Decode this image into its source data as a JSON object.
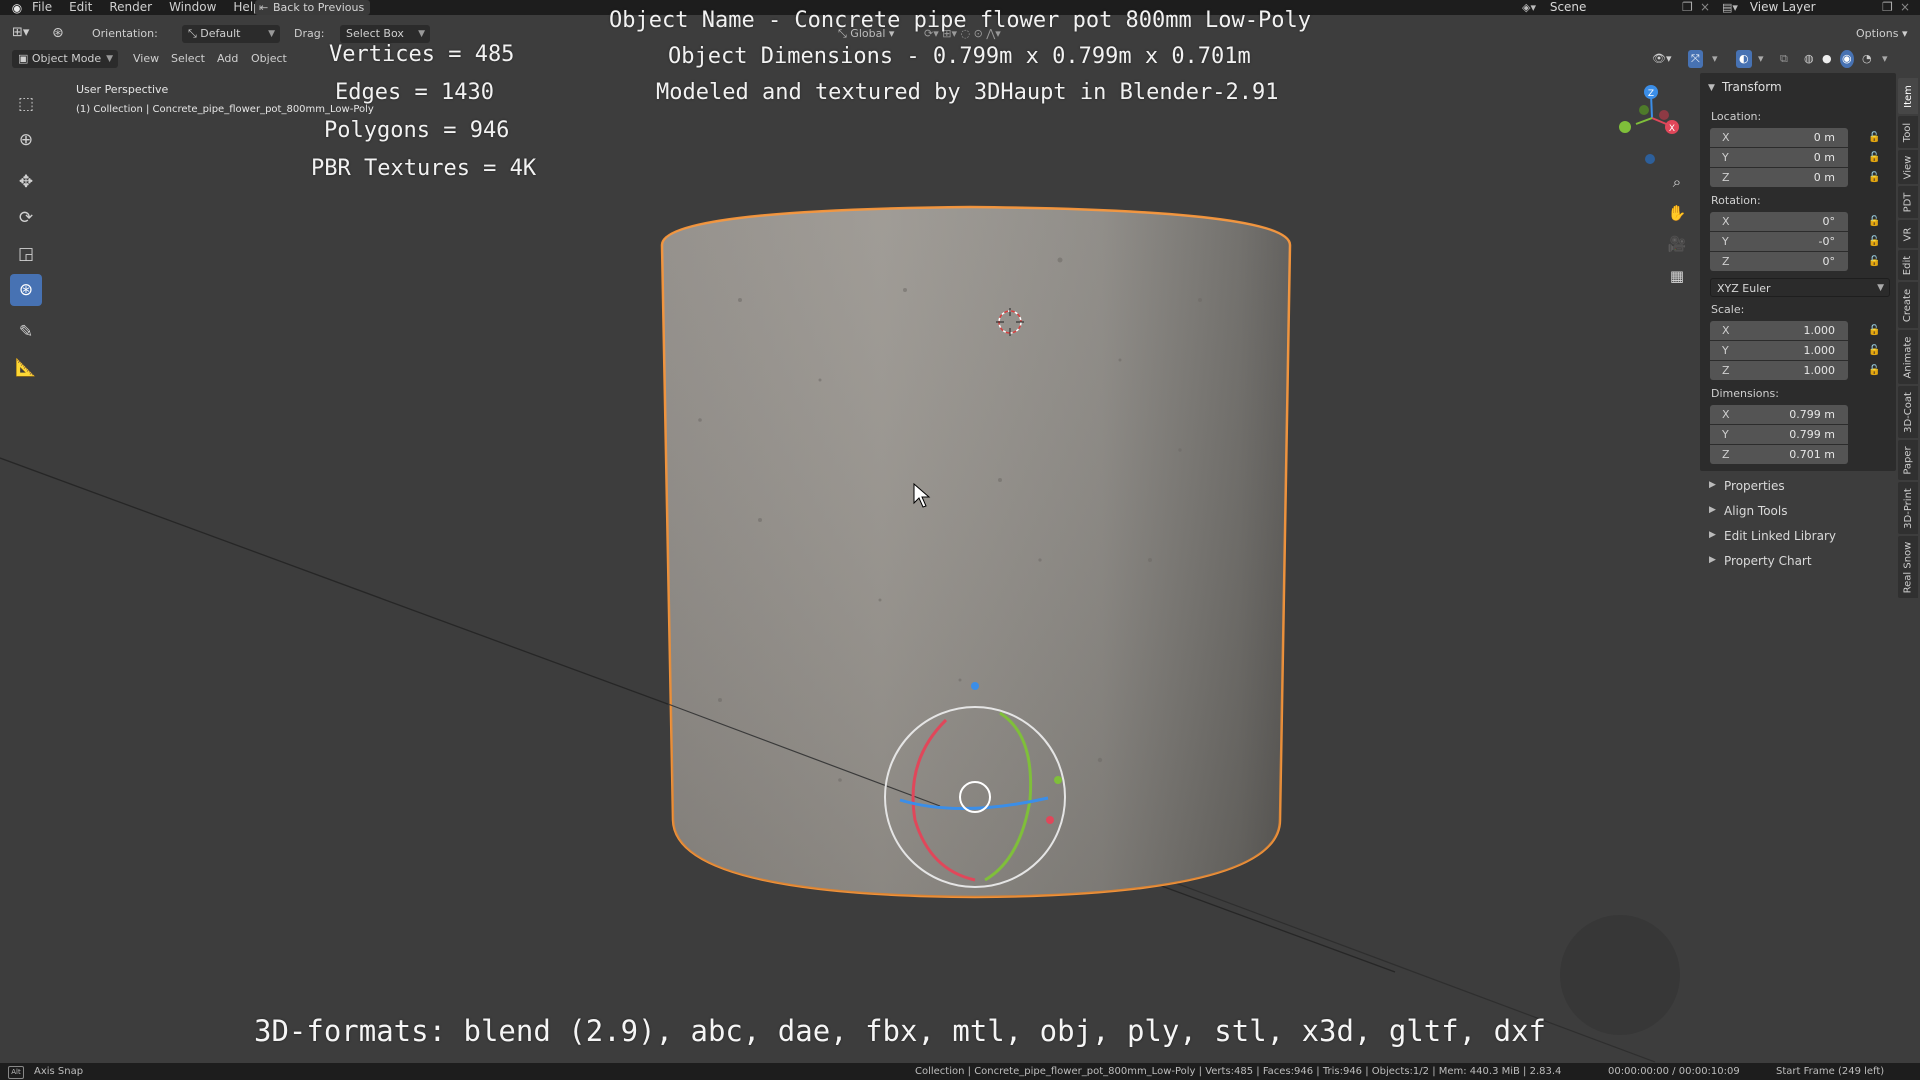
{
  "menu": {
    "items": [
      "File",
      "Edit",
      "Render",
      "Window",
      "Help"
    ],
    "back_button": "Back to Previous"
  },
  "scene": {
    "label": "Scene"
  },
  "view_layer": {
    "label": "View Layer"
  },
  "header": {
    "orientation_label": "Orientation:",
    "orientation_value": "Default",
    "drag_label": "Drag:",
    "drag_value": "Select Box",
    "transform_space": "Global",
    "options_label": "Options",
    "mode": "Object Mode",
    "menus": [
      "View",
      "Select",
      "Add",
      "Object"
    ]
  },
  "viewport": {
    "perspective_label": "User Perspective",
    "collection_label": "(1) Collection | Concrete_pipe_flower_pot_800mm_Low-Poly",
    "stats": {
      "vertices": "Vertices = 485",
      "edges": "Edges = 1430",
      "polygons": "Polygons = 946",
      "textures": "PBR Textures = 4K"
    },
    "overlay_title": "Object Name - Concrete pipe flower pot 800mm Low-Poly",
    "overlay_dimensions": "Object Dimensions -  0.799m x 0.799m x 0.701m",
    "overlay_credit": "Modeled and textured by 3DHaupt in Blender-2.91",
    "formats_line": "3D-formats: blend (2.9), abc, dae, fbx, mtl, obj, ply, stl, x3d, gltf, dxf",
    "gizmo_axes": {
      "x": "X",
      "y": "Y",
      "z": "Z"
    }
  },
  "npanel": {
    "transform_title": "Transform",
    "location_label": "Location:",
    "location": [
      {
        "axis": "X",
        "value": "0 m"
      },
      {
        "axis": "Y",
        "value": "0 m"
      },
      {
        "axis": "Z",
        "value": "0 m"
      }
    ],
    "rotation_label": "Rotation:",
    "rotation": [
      {
        "axis": "X",
        "value": "0°"
      },
      {
        "axis": "Y",
        "value": "-0°"
      },
      {
        "axis": "Z",
        "value": "0°"
      }
    ],
    "rotation_mode": "XYZ Euler",
    "scale_label": "Scale:",
    "scale": [
      {
        "axis": "X",
        "value": "1.000"
      },
      {
        "axis": "Y",
        "value": "1.000"
      },
      {
        "axis": "Z",
        "value": "1.000"
      }
    ],
    "dimensions_label": "Dimensions:",
    "dimensions": [
      {
        "axis": "X",
        "value": "0.799 m"
      },
      {
        "axis": "Y",
        "value": "0.799 m"
      },
      {
        "axis": "Z",
        "value": "0.701 m"
      }
    ],
    "collapsed_sections": [
      "Properties",
      "Align Tools",
      "Edit Linked Library",
      "Property Chart"
    ]
  },
  "vertical_tabs": [
    "Item",
    "Tool",
    "View",
    "PDT",
    "VR",
    "Edit",
    "Create",
    "Animate",
    "3D-Coat",
    "Paper",
    "3D-Print",
    "Real Snow"
  ],
  "status": {
    "key_hint": "Alt",
    "snap_label": "Axis Snap",
    "info": "Collection | Concrete_pipe_flower_pot_800mm_Low-Poly | Verts:485 | Faces:946 | Tris:946 | Objects:1/2 | Mem: 440.3 MiB | 2.83.4",
    "time": "00:00:00:00 / 00:00:10:09",
    "frame": "Start Frame (249 left)"
  },
  "colors": {
    "selection_outline": "#f0923a",
    "active_tool": "#4772b3",
    "axis_x": "#e0475a",
    "axis_y": "#7fbf3a",
    "axis_z": "#3b8ee8",
    "viewport_bg": "#3d3d3d"
  },
  "icons": {
    "toolbar": [
      "select-box-icon",
      "cursor-icon",
      "move-icon",
      "rotate-icon",
      "scale-icon",
      "transform-icon",
      "annotate-icon",
      "measure-icon"
    ],
    "navigation": [
      "zoom-icon",
      "hand-pan-icon",
      "camera-icon",
      "grid-ortho-icon"
    ]
  }
}
